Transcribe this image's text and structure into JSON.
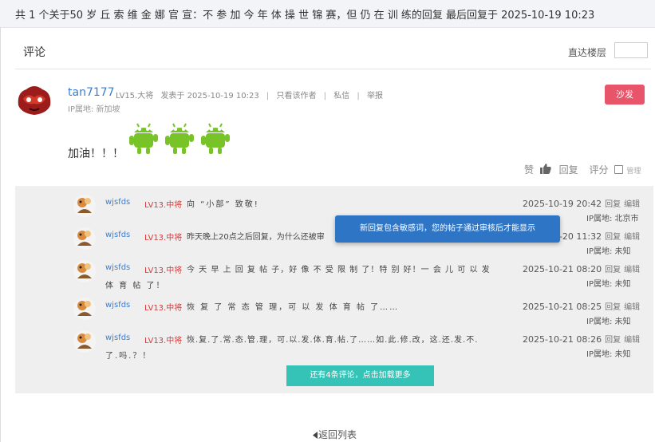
{
  "topbar": {
    "text": "共 1 个关于50 岁 丘 索 维 金 娜 官 宣：不 参 加 今 年 体 操 世 锦 赛，但 仍 在 训 练的回复 最后回复于 2025-10-19 10:23"
  },
  "header": {
    "title": "评论",
    "jump_label": "直达楼层"
  },
  "post": {
    "username": "tan7177",
    "level": "LV15.大将",
    "posted_at": "发表于 2025-10-19 10:23",
    "only_author": "只看该作者",
    "message": "私信",
    "report": "举报",
    "ip": "IP属地: 新加坡",
    "sofa": "沙发",
    "content": "加油！！！",
    "emoji_icon": "android-thumbs-up-icon",
    "actions": {
      "like": "赞",
      "reply": "回复",
      "rate": "评分",
      "manage": "管理"
    }
  },
  "replies": [
    {
      "name": "wjsfds",
      "level": "LV13.中将",
      "text": "向 “小部” 致敬!",
      "text2": "",
      "time": "2025-10-19 20:42",
      "reply": "回复",
      "edit": "编辑",
      "ip": "IP属地: 北京市"
    },
    {
      "name": "wjsfds",
      "level": "LV13.中将",
      "text": "昨天晚上20点之后回复，为什么还被审",
      "text2": "",
      "time": "2025-10-20 11:32",
      "reply": "回复",
      "edit": "编辑",
      "ip": "IP属地: 未知"
    },
    {
      "name": "wjsfds",
      "level": "LV13.中将",
      "text": "今 天 早 上 回 复 帖 子，好 像 不 受 限 制 了！特 别 好！一 会 儿 可 以 发",
      "text2": "体 育 帖 了！",
      "time": "2025-10-21 08:20",
      "reply": "回复",
      "edit": "编辑",
      "ip": "IP属地: 未知"
    },
    {
      "name": "wjsfds",
      "level": "LV13.中将",
      "text": "恢 复 了 常 态 管 理，可 以 发 体 育 帖 了……",
      "text2": "",
      "time": "2025-10-21 08:25",
      "reply": "回复",
      "edit": "编辑",
      "ip": "IP属地: 未知"
    },
    {
      "name": "wjsfds",
      "level": "LV13.中将",
      "text": "恢.复.了.常.态.管.理，可.以.发.体.育.帖.了……如.此.修.改，这.还.发.不.",
      "text2": "了.吗.？！",
      "time": "2025-10-21 08:26",
      "reply": "回复",
      "edit": "编辑",
      "ip": "IP属地: 未知"
    }
  ],
  "load_more": "还有4条评论，点击加载更多",
  "toast": "新回复包含敏感词，您的帖子通过审核后才能显示",
  "back": "返回列表",
  "colors": {
    "accent": "#3b7ed0",
    "sofa": "#e8546a",
    "loadmore": "#35c3b7",
    "toast": "#2e76c5",
    "level_red": "#d43b3b"
  }
}
